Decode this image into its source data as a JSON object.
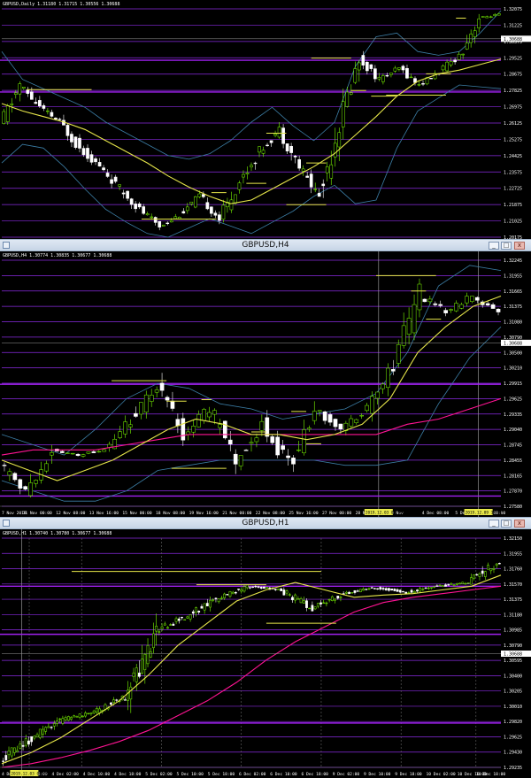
{
  "colors": {
    "bg": "#000000",
    "grid_h": "#8a2be2",
    "grid_v": "#2a2a2a",
    "up_fill": "#000000",
    "up_stroke": "#7cfc00",
    "down_fill": "#ffffff",
    "down_stroke": "#ffffff",
    "ma_slow": "#ff1493",
    "ma_fast": "#e6e64a",
    "band": "#3c7ea6",
    "annot": "#e6e64a",
    "white": "#ffffff"
  },
  "window_titles": {
    "h4": "GBPUSD,H4",
    "h1": "GBPUSD,H1"
  },
  "chart_data": [
    {
      "type": "candlestick",
      "symbol": "GBPUSD",
      "timeframe": "Daily",
      "info": "GBPUSD,Daily  1.31180 1.31715 1.30556 1.30688",
      "y_ticks": [
        "1.32075",
        "1.31225",
        "1.30375",
        "1.29525",
        "1.28675",
        "1.27825",
        "1.26975",
        "1.26125",
        "1.25275",
        "1.24425",
        "1.23575",
        "1.22725",
        "1.21875",
        "1.21025",
        "1.20175"
      ],
      "ylim": [
        1.2,
        1.323
      ],
      "current_price": "1.30688",
      "x_labels": [],
      "h_lines": [
        1.2953,
        1.2782
      ],
      "fast_ma": [
        1.272,
        1.268,
        1.265,
        1.262,
        1.258,
        1.252,
        1.246,
        1.24,
        1.233,
        1.227,
        1.222,
        1.218,
        1.22,
        1.226,
        1.232,
        1.238,
        1.245,
        1.255,
        1.265,
        1.276,
        1.284,
        1.288,
        1.29,
        1.293,
        1.296
      ],
      "band_upper": [
        1.3,
        1.285,
        1.28,
        1.275,
        1.27,
        1.262,
        1.256,
        1.25,
        1.244,
        1.242,
        1.245,
        1.252,
        1.262,
        1.27,
        1.26,
        1.252,
        1.262,
        1.292,
        1.308,
        1.31,
        1.3,
        1.298,
        1.3,
        1.31,
        1.322
      ],
      "band_lower": [
        1.24,
        1.25,
        1.248,
        1.238,
        1.226,
        1.215,
        1.208,
        1.202,
        1.2,
        1.205,
        1.21,
        1.206,
        1.202,
        1.208,
        1.214,
        1.222,
        1.228,
        1.218,
        1.22,
        1.248,
        1.268,
        1.275,
        1.282,
        1.281,
        1.28
      ],
      "segments": [
        [
          1.26,
          1.282
        ],
        [
          1.282,
          1.27
        ],
        [
          1.27,
          1.262
        ],
        [
          1.262,
          1.248
        ],
        [
          1.248,
          1.238
        ],
        [
          1.238,
          1.226
        ],
        [
          1.226,
          1.215
        ],
        [
          1.215,
          1.206
        ],
        [
          1.206,
          1.212
        ],
        [
          1.212,
          1.222
        ],
        [
          1.222,
          1.21
        ],
        [
          1.21,
          1.23
        ],
        [
          1.23,
          1.246
        ],
        [
          1.246,
          1.258
        ],
        [
          1.258,
          1.238
        ],
        [
          1.238,
          1.222
        ],
        [
          1.222,
          1.262
        ],
        [
          1.262,
          1.296
        ],
        [
          1.296,
          1.285
        ],
        [
          1.285,
          1.291
        ],
        [
          1.291,
          1.282
        ],
        [
          1.282,
          1.289
        ],
        [
          1.289,
          1.298
        ],
        [
          1.298,
          1.318
        ],
        [
          1.318,
          1.32
        ]
      ],
      "annotations": [
        [
          0.05,
          0.18,
          1.2795
        ],
        [
          0.28,
          0.43,
          1.2098
        ],
        [
          0.42,
          0.45,
          1.224
        ],
        [
          0.49,
          0.53,
          1.229
        ],
        [
          0.53,
          0.57,
          1.256
        ],
        [
          0.61,
          0.65,
          1.24
        ],
        [
          0.57,
          0.65,
          1.2175
        ],
        [
          0.62,
          0.7,
          1.2965
        ],
        [
          0.7,
          0.73,
          1.279
        ],
        [
          0.74,
          0.79,
          1.276
        ],
        [
          0.77,
          0.89,
          1.2765
        ],
        [
          0.85,
          0.9,
          1.288
        ],
        [
          0.91,
          0.93,
          1.318
        ]
      ]
    },
    {
      "type": "candlestick",
      "symbol": "GBPUSD",
      "timeframe": "H4",
      "info": "GBPUSD,H4  1.30774 1.30835 1.30677 1.30688",
      "y_ticks": [
        "1.32245",
        "1.31955",
        "1.31665",
        "1.31375",
        "1.31080",
        "1.30790",
        "1.30500",
        "1.30210",
        "1.29915",
        "1.29625",
        "1.29335",
        "1.29040",
        "1.28745",
        "1.28455",
        "1.28165",
        "1.27870",
        "1.27580"
      ],
      "ylim": [
        1.275,
        1.323
      ],
      "current_price": "1.30688",
      "x_labels": [
        "7 Nov 2019",
        "11 Nov 00:00",
        "12 Nov 08:00",
        "13 Nov 16:00",
        "15 Nov 00:00",
        "18 Nov 08:00",
        "19 Nov 16:00",
        "21 Nov 00:00",
        "22 Nov 08:00",
        "25 Nov 16:00",
        "27 Nov 00:00",
        "28 Nov 08:00",
        "29 Nov",
        "4 Dec 08:00",
        "5 Dec 16:00",
        "10 Dec 08:00"
      ],
      "highlight_labels": [
        "2019.12.03 04:00",
        "2019.12.09 16:00"
      ],
      "h_lines": [
        1.2988,
        1.277
      ],
      "fast_ma": [
        1.284,
        1.282,
        1.28,
        1.282,
        1.284,
        1.287,
        1.29,
        1.292,
        1.291,
        1.289,
        1.289,
        1.288,
        1.289,
        1.291,
        1.296,
        1.305,
        1.31,
        1.314,
        1.316
      ],
      "slow_ma": [
        1.285,
        1.286,
        1.286,
        1.286,
        1.287,
        1.288,
        1.289,
        1.289,
        1.289,
        1.289,
        1.289,
        1.289,
        1.289,
        1.291,
        1.292,
        1.294,
        1.296
      ],
      "band_upper": [
        1.289,
        1.287,
        1.285,
        1.29,
        1.296,
        1.299,
        1.298,
        1.295,
        1.294,
        1.292,
        1.293,
        1.294,
        1.297,
        1.305,
        1.318,
        1.322,
        1.321
      ],
      "band_lower": [
        1.28,
        1.278,
        1.276,
        1.276,
        1.278,
        1.282,
        1.283,
        1.284,
        1.284,
        1.284,
        1.284,
        1.283,
        1.283,
        1.284,
        1.295,
        1.304,
        1.31
      ],
      "segments": [
        [
          1.283,
          1.278
        ],
        [
          1.278,
          1.286
        ],
        [
          1.286,
          1.285
        ],
        [
          1.285,
          1.286
        ],
        [
          1.286,
          1.292
        ],
        [
          1.292,
          1.298
        ],
        [
          1.298,
          1.289
        ],
        [
          1.289,
          1.294
        ],
        [
          1.294,
          1.284
        ],
        [
          1.284,
          1.291
        ],
        [
          1.291,
          1.283
        ],
        [
          1.283,
          1.294
        ],
        [
          1.294,
          1.29
        ],
        [
          1.29,
          1.294
        ],
        [
          1.294,
          1.303
        ],
        [
          1.303,
          1.316
        ],
        [
          1.316,
          1.313
        ],
        [
          1.313,
          1.316
        ],
        [
          1.316,
          1.313
        ]
      ],
      "annotations": [
        [
          0.22,
          0.33,
          1.2995
        ],
        [
          0.33,
          0.37,
          1.2955
        ],
        [
          0.4,
          0.42,
          1.2958
        ],
        [
          0.34,
          0.45,
          1.2824
        ],
        [
          0.58,
          0.61,
          1.2935
        ],
        [
          0.5,
          0.53,
          1.2895
        ],
        [
          0.61,
          0.64,
          1.2872
        ],
        [
          0.75,
          0.87,
          1.32
        ],
        [
          0.82,
          0.85,
          1.317
        ],
        [
          0.85,
          0.88,
          1.3115
        ]
      ]
    },
    {
      "type": "candlestick",
      "symbol": "GBPUSD",
      "timeframe": "H1",
      "info": "GBPUSD,H1  1.30740 1.30780 1.30677 1.30688",
      "y_ticks": [
        "1.32150",
        "1.31955",
        "1.31760",
        "1.31570",
        "1.31375",
        "1.31180",
        "1.30985",
        "1.30790",
        "1.30595",
        "1.30400",
        "1.30205",
        "1.30010",
        "1.29820",
        "1.29625",
        "1.29430",
        "1.29235"
      ],
      "ylim": [
        1.2915,
        1.3225
      ],
      "current_price": "1.30688",
      "x_labels": [
        "4 Dec 10:00",
        "4 Dec 18:00",
        "4 Dec 02:00",
        "4 Dec 10:00",
        "4 Dec 18:00",
        "5 Dec 02:00",
        "5 Dec 10:00",
        "5 Dec 18:00",
        "6 Dec 02:00",
        "6 Dec 10:00",
        "6 Dec 18:00",
        "9 Dec 02:00",
        "9 Dec 10:00",
        "9 Dec 18:00",
        "10 Dec 02:00",
        "10 Dec 10:00",
        "10 Dec 18:00"
      ],
      "highlight_labels": [
        "2019.12.03 04:00"
      ],
      "h_lines": [
        1.316,
        1.3095,
        1.2975
      ],
      "fast_ma": [
        1.292,
        1.2935,
        1.2955,
        1.298,
        1.3005,
        1.304,
        1.308,
        1.311,
        1.314,
        1.3155,
        1.3165,
        1.3155,
        1.3145,
        1.3148,
        1.315,
        1.3155,
        1.316,
        1.3175
      ],
      "slow_ma": [
        1.2915,
        1.292,
        1.2928,
        1.2938,
        1.295,
        1.2965,
        1.2985,
        1.3005,
        1.303,
        1.306,
        1.3085,
        1.3105,
        1.3125,
        1.3138,
        1.3145,
        1.315,
        1.3155,
        1.316
      ],
      "segments": [
        [
          1.2925,
          1.2955
        ],
        [
          1.2955,
          1.298
        ],
        [
          1.298,
          1.299
        ],
        [
          1.299,
          1.301
        ],
        [
          1.301,
          1.31
        ],
        [
          1.31,
          1.312
        ],
        [
          1.312,
          1.3145
        ],
        [
          1.3145,
          1.316
        ],
        [
          1.316,
          1.3155
        ],
        [
          1.3155,
          1.313
        ],
        [
          1.313,
          1.315
        ],
        [
          1.315,
          1.3158
        ],
        [
          1.3158,
          1.3152
        ],
        [
          1.3152,
          1.316
        ],
        [
          1.316,
          1.3165
        ],
        [
          1.3165,
          1.3195
        ]
      ],
      "annotations": [
        [
          0.14,
          0.64,
          1.318
        ],
        [
          0.39,
          0.53,
          1.3162
        ],
        [
          0.53,
          0.67,
          1.311
        ]
      ]
    }
  ]
}
